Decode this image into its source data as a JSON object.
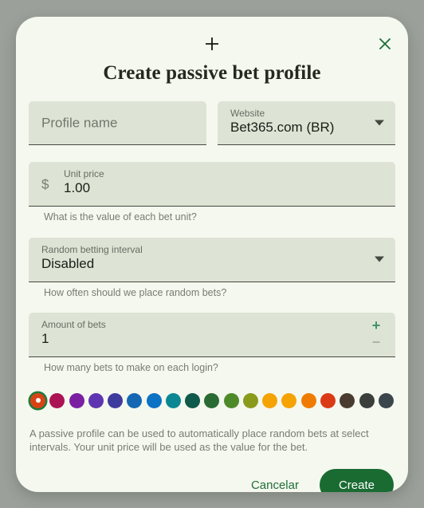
{
  "dialog": {
    "title": "Create passive bet profile",
    "handle_icon": "plus-icon",
    "close_icon": "close-icon",
    "accent_color": "#1a6b32",
    "card_color": "#f5f8ef",
    "field_color": "#dde4d6",
    "backdrop_color": "#9ba19a"
  },
  "fields": {
    "profile_name": {
      "placeholder": "Profile name",
      "value": ""
    },
    "website": {
      "label": "Website",
      "value": "Bet365.com (BR)",
      "caret_icon": "chevron-down-icon"
    },
    "unit_price": {
      "label": "Unit price",
      "value": "1.00",
      "prefix": "$",
      "helper": "What is the value of each bet unit?"
    },
    "random_interval": {
      "label": "Random betting interval",
      "value": "Disabled",
      "helper": "How often should we place random bets?",
      "caret_icon": "chevron-down-icon"
    },
    "amount_of_bets": {
      "label": "Amount of bets",
      "value": "1",
      "helper": "How many bets to make on each login?",
      "increment": "+",
      "decrement": "–"
    }
  },
  "color_picker": {
    "selected_index": 0,
    "swatches": [
      "#d84315",
      "#ac1354",
      "#7b1fa2",
      "#5e35b1",
      "#3f3a9e",
      "#1567b3",
      "#0b72c4",
      "#0b8793",
      "#0f5a4a",
      "#2a6b33",
      "#4e8a2a",
      "#8a9b1c",
      "#f5a302",
      "#f5a302",
      "#ef7c00",
      "#db3a16",
      "#4a3b30",
      "#3b3f3c",
      "#3b454c"
    ]
  },
  "description": "A passive profile can be used to automatically place random bets at select intervals. Your unit price will be used as the value for the bet.",
  "actions": {
    "cancel_label": "Cancelar",
    "create_label": "Create"
  }
}
